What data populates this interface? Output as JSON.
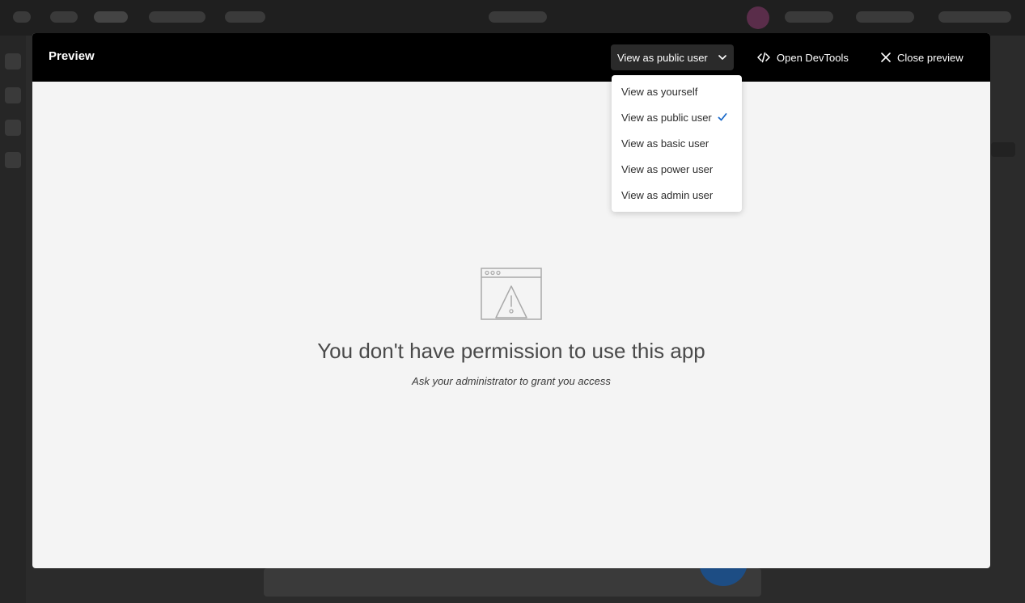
{
  "modal": {
    "title": "Preview",
    "view_select": {
      "selected": "View as public user"
    },
    "devtools_label": "Open DevTools",
    "close_label": "Close preview"
  },
  "dropdown": {
    "options": [
      {
        "label": "View as yourself",
        "selected": false
      },
      {
        "label": "View as public user",
        "selected": true
      },
      {
        "label": "View as basic user",
        "selected": false
      },
      {
        "label": "View as power user",
        "selected": false
      },
      {
        "label": "View as admin user",
        "selected": false
      }
    ],
    "check_color": "#1b6ac9"
  },
  "empty_state": {
    "icon": "browser-warning-icon",
    "title": "You don't have permission to use this app",
    "subtitle": "Ask your administrator to grant you access"
  }
}
